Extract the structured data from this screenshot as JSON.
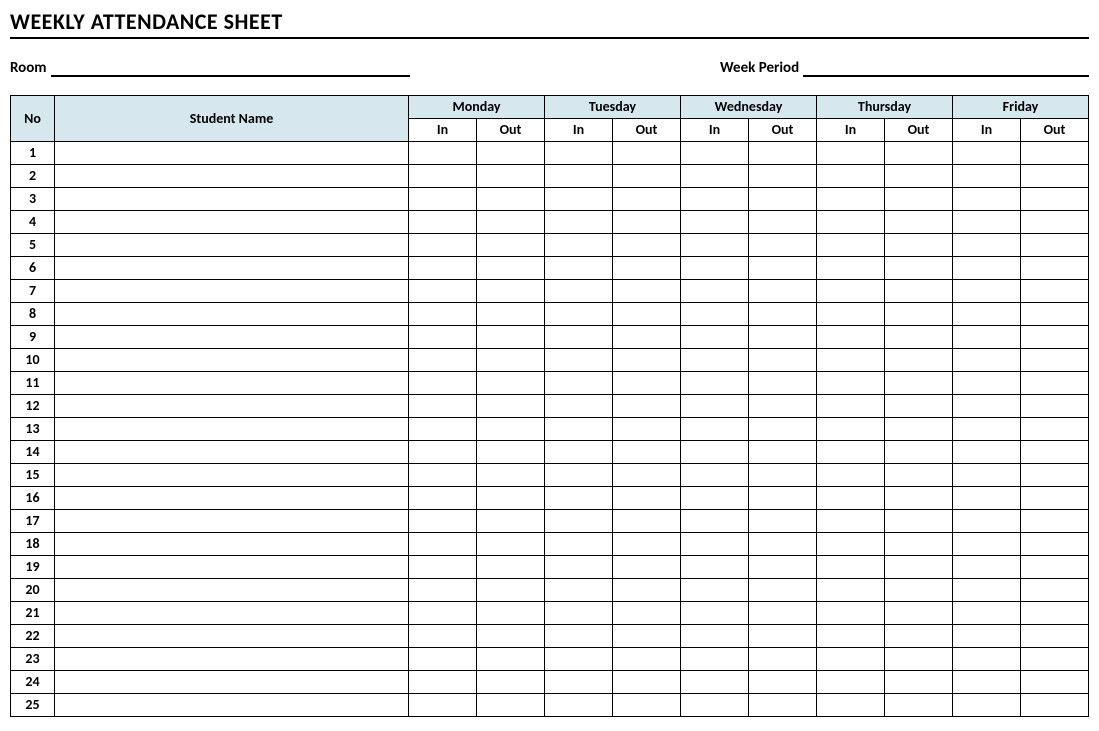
{
  "title": "WEEKLY ATTENDANCE SHEET",
  "meta": {
    "room_label": "Room",
    "room_value": "",
    "week_label": "Week Period",
    "week_value": ""
  },
  "header": {
    "no": "No",
    "student_name": "Student Name",
    "days": [
      "Monday",
      "Tuesday",
      "Wednesday",
      "Thursday",
      "Friday"
    ],
    "in": "In",
    "out": "Out"
  },
  "rows": [
    {
      "no": "1"
    },
    {
      "no": "2"
    },
    {
      "no": "3"
    },
    {
      "no": "4"
    },
    {
      "no": "5"
    },
    {
      "no": "6"
    },
    {
      "no": "7"
    },
    {
      "no": "8"
    },
    {
      "no": "9"
    },
    {
      "no": "10"
    },
    {
      "no": "11"
    },
    {
      "no": "12"
    },
    {
      "no": "13"
    },
    {
      "no": "14"
    },
    {
      "no": "15"
    },
    {
      "no": "16"
    },
    {
      "no": "17"
    },
    {
      "no": "18"
    },
    {
      "no": "19"
    },
    {
      "no": "20"
    },
    {
      "no": "21"
    },
    {
      "no": "22"
    },
    {
      "no": "23"
    },
    {
      "no": "24"
    },
    {
      "no": "25"
    }
  ]
}
